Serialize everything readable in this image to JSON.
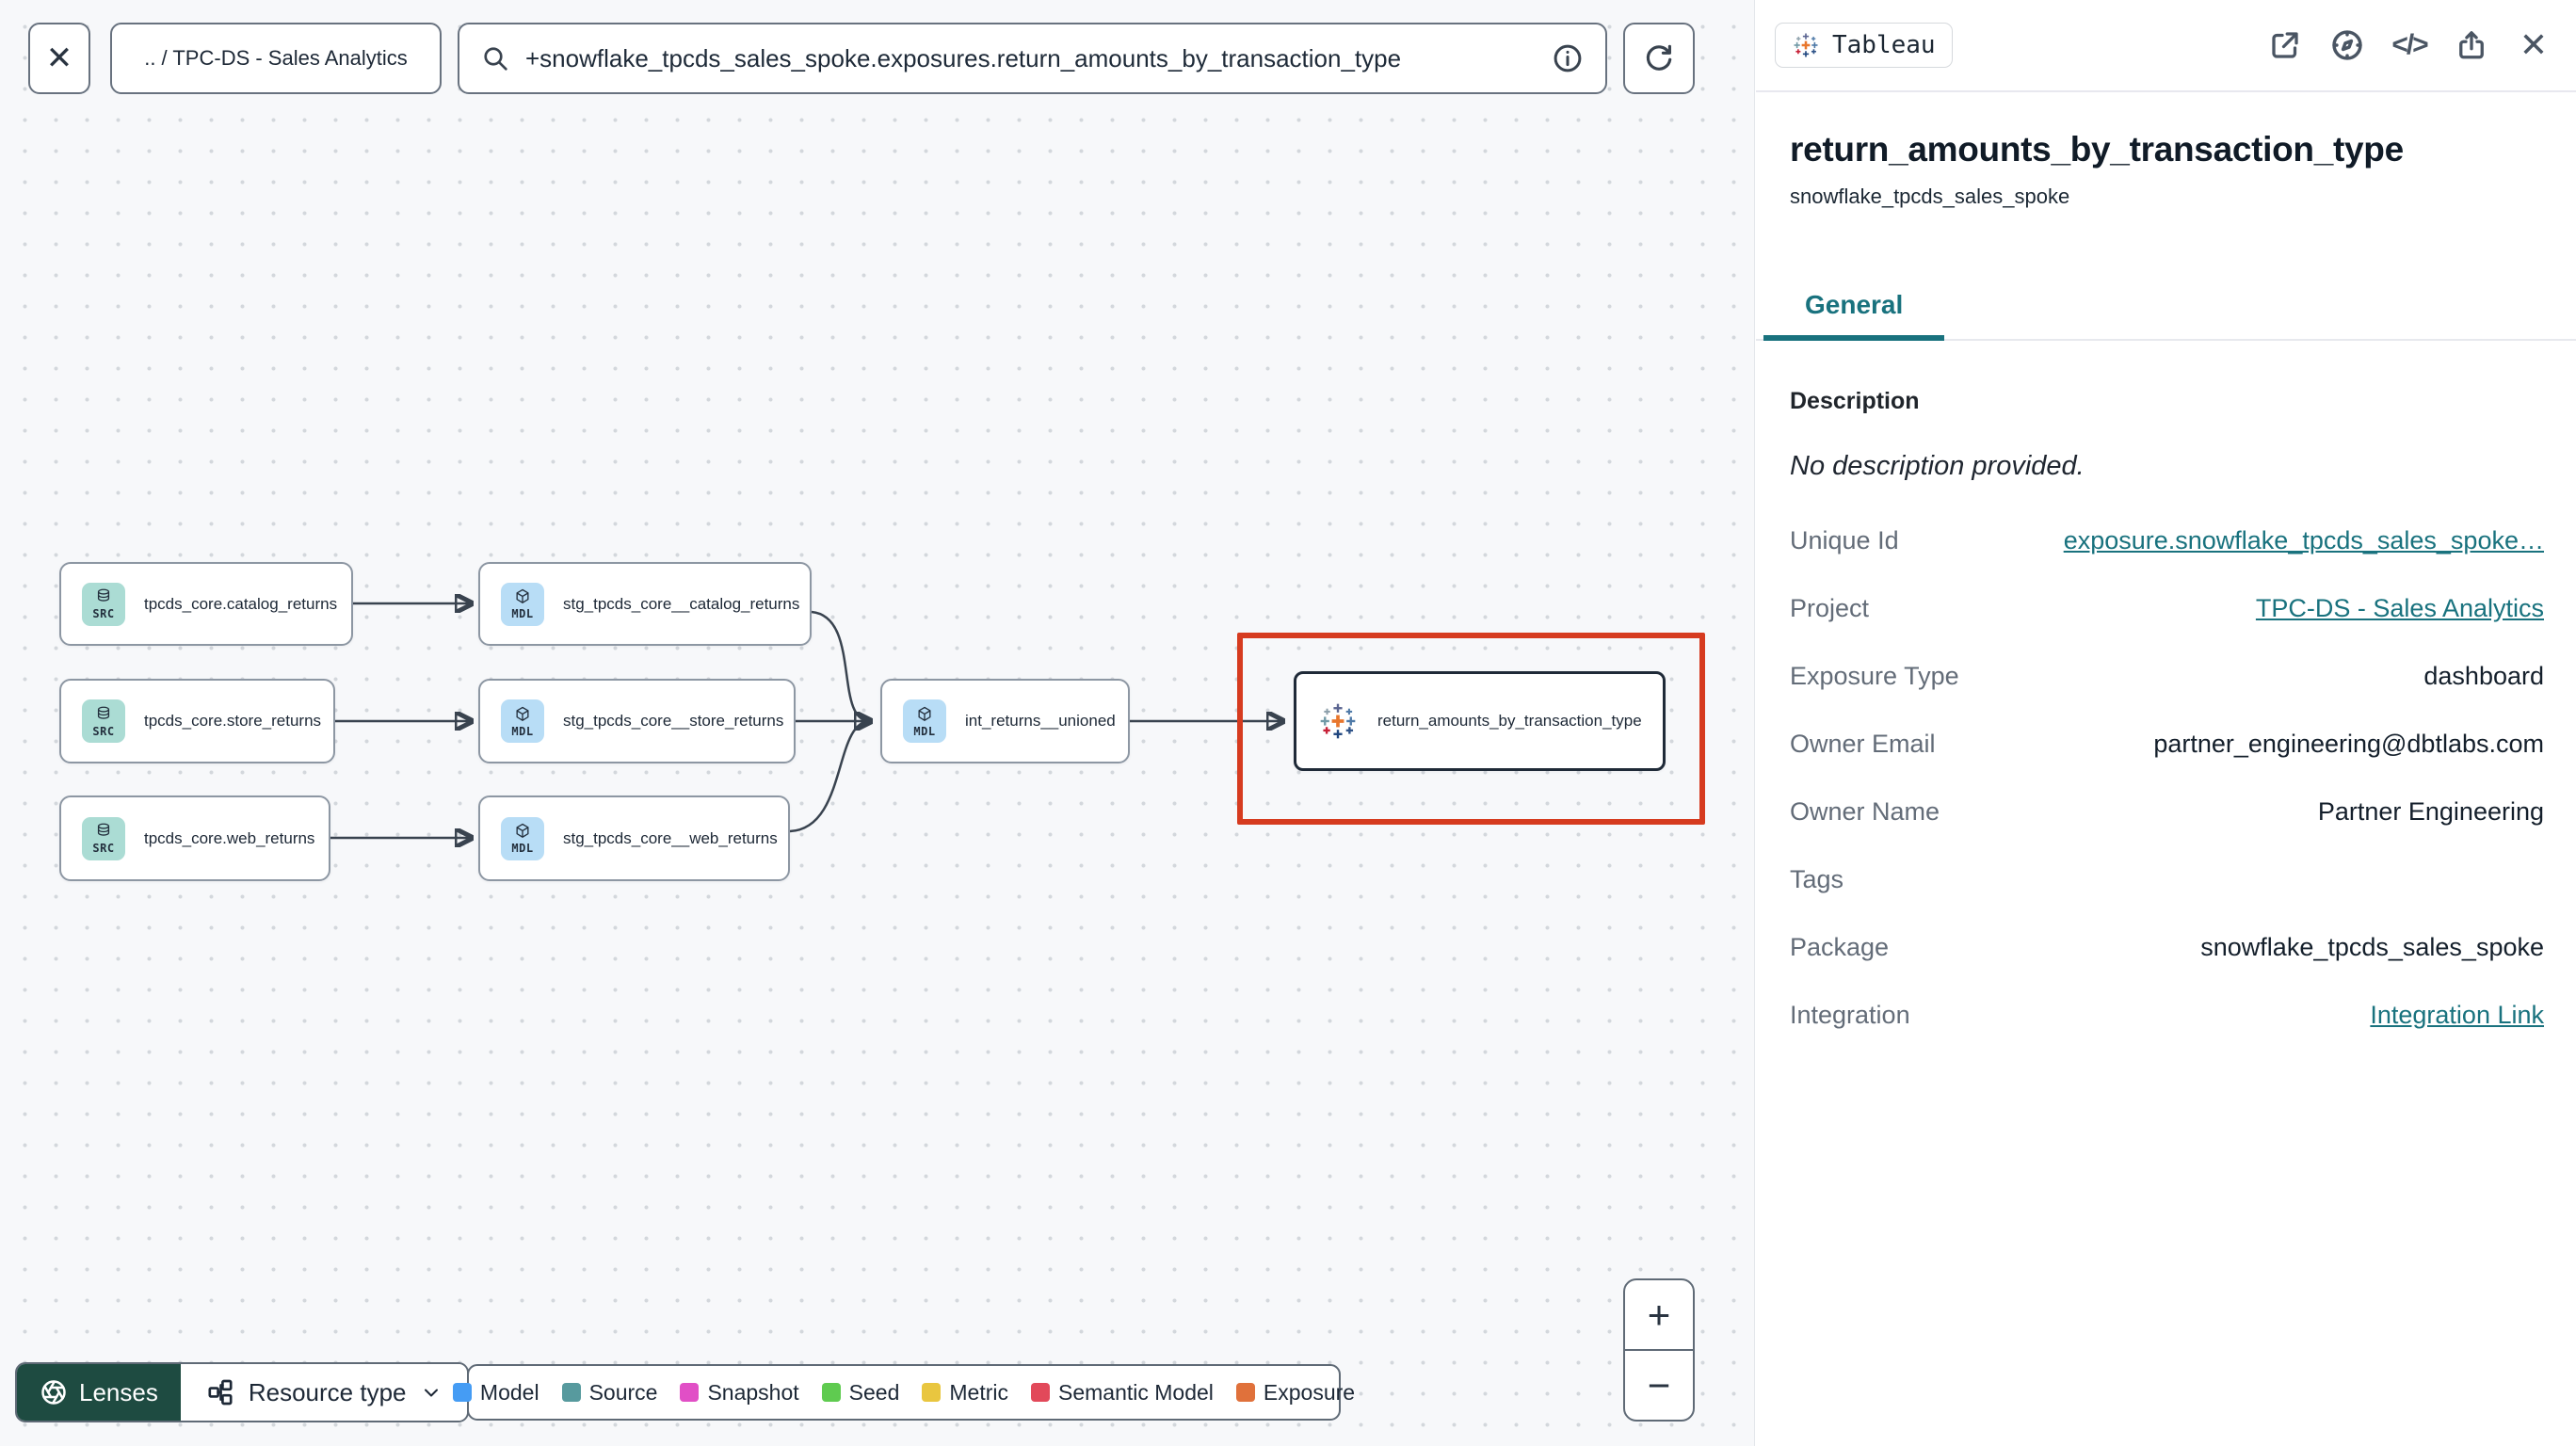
{
  "topbar": {
    "close_glyph": "✕",
    "breadcrumb": ".. / TPC-DS - Sales Analytics",
    "search": {
      "value": "+snowflake_tpcds_sales_spoke.exposures.return_amounts_by_transaction_type"
    }
  },
  "graph": {
    "nodes": [
      {
        "type": "source",
        "badge": "SRC",
        "label": "tpcds_core.catalog_returns"
      },
      {
        "type": "source",
        "badge": "SRC",
        "label": "tpcds_core.store_returns"
      },
      {
        "type": "source",
        "badge": "SRC",
        "label": "tpcds_core.web_returns"
      },
      {
        "type": "model",
        "badge": "MDL",
        "label": "stg_tpcds_core__catalog_returns"
      },
      {
        "type": "model",
        "badge": "MDL",
        "label": "stg_tpcds_core__store_returns"
      },
      {
        "type": "model",
        "badge": "MDL",
        "label": "stg_tpcds_core__web_returns"
      },
      {
        "type": "model",
        "badge": "MDL",
        "label": "int_returns__unioned"
      },
      {
        "type": "exposure",
        "label": "return_amounts_by_transaction_type",
        "selected": true
      }
    ],
    "lenses_label": "Lenses",
    "resource_type_label": "Resource type",
    "legend": [
      {
        "label": "Model",
        "color": "#459cf4"
      },
      {
        "label": "Source",
        "color": "#579a9e"
      },
      {
        "label": "Snapshot",
        "color": "#e14fc6"
      },
      {
        "label": "Seed",
        "color": "#5fcb50"
      },
      {
        "label": "Metric",
        "color": "#e9c63f"
      },
      {
        "label": "Semantic Model",
        "color": "#e2495a"
      },
      {
        "label": "Exposure",
        "color": "#e0713b"
      }
    ],
    "zoom": {
      "in": "+",
      "out": "−"
    }
  },
  "panel": {
    "integration_badge": "Tableau",
    "code_icon_glyph": "</>",
    "close_glyph": "✕",
    "title": "return_amounts_by_transaction_type",
    "subtitle": "snowflake_tpcds_sales_spoke",
    "tabs": [
      {
        "label": "General",
        "active": true
      }
    ],
    "description_header": "Description",
    "description_empty": "No description provided.",
    "rows": [
      {
        "label": "Unique Id",
        "value": "exposure.snowflake_tpcds_sales_spoke…",
        "link": true
      },
      {
        "label": "Project",
        "value": "TPC-DS - Sales Analytics",
        "link": true
      },
      {
        "label": "Exposure Type",
        "value": "dashboard"
      },
      {
        "label": "Owner Email",
        "value": "partner_engineering@dbtlabs.com"
      },
      {
        "label": "Owner Name",
        "value": "Partner Engineering"
      },
      {
        "label": "Tags",
        "value": ""
      },
      {
        "label": "Package",
        "value": "snowflake_tpcds_sales_spoke"
      },
      {
        "label": "Integration",
        "value": "Integration Link",
        "link": true
      }
    ]
  },
  "colors": {
    "accent_teal": "#19727e",
    "selection_highlight_red": "#d63b1f",
    "lenses_green": "#1e4b41",
    "source_badge_bg": "#abdcd4",
    "model_badge_bg": "#b8ddf6"
  }
}
